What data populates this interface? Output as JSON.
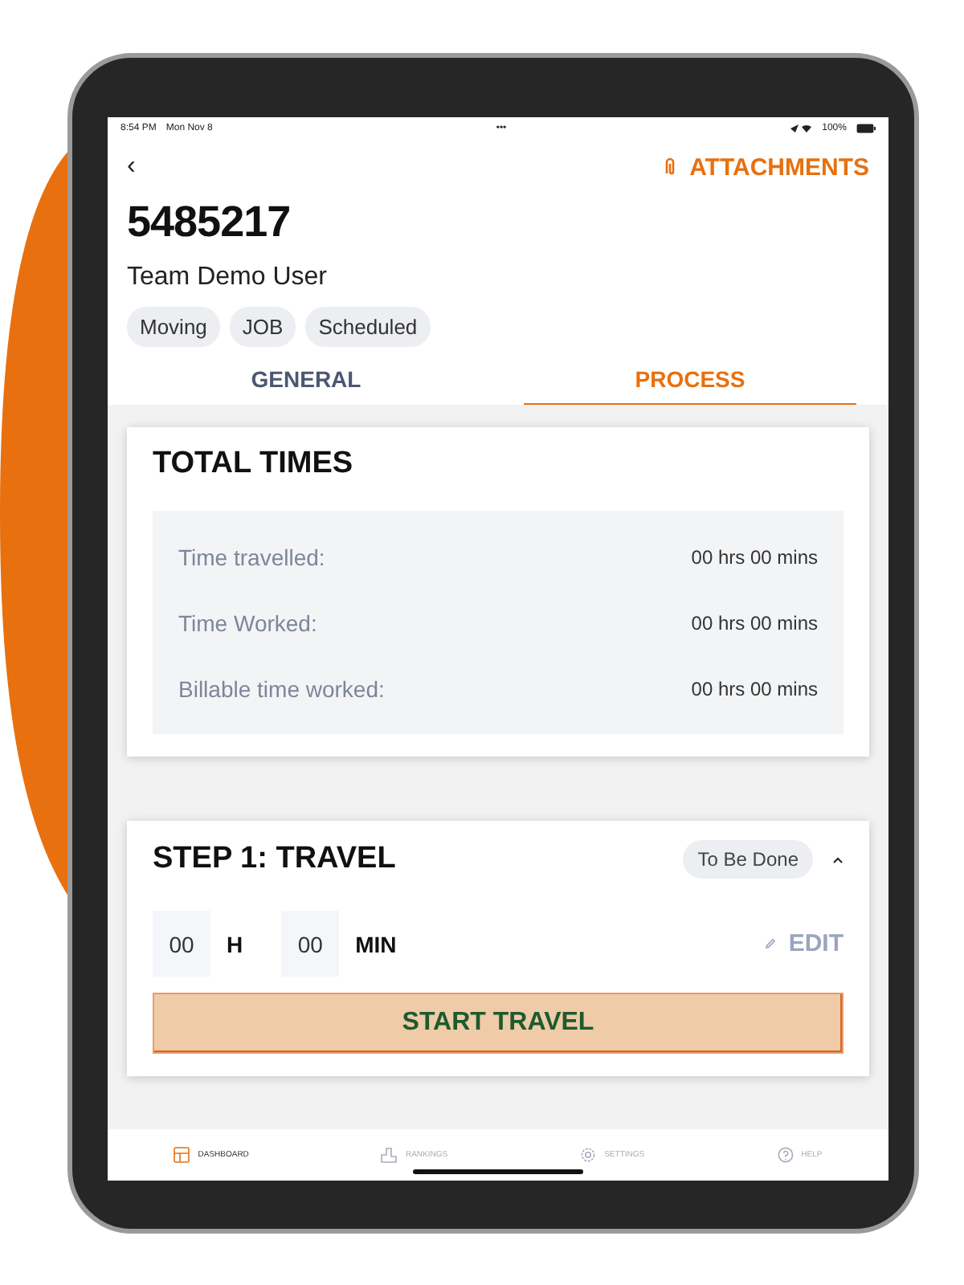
{
  "status_bar": {
    "time": "8:54 PM",
    "date": "Mon Nov 8",
    "dots": "•••",
    "battery": "100%"
  },
  "header": {
    "back": "‹",
    "attachments": "ATTACHMENTS"
  },
  "job": {
    "number": "5485217",
    "user": "Team Demo User",
    "tags": [
      "Moving",
      "JOB",
      "Scheduled"
    ]
  },
  "tabs": [
    {
      "label": "GENERAL",
      "selected": false
    },
    {
      "label": "PROCESS",
      "selected": true
    }
  ],
  "total_times": {
    "title": "TOTAL TIMES",
    "rows": [
      {
        "label": "Time travelled:",
        "value": "00 hrs 00 mins"
      },
      {
        "label": "Time Worked:",
        "value": "00 hrs 00 mins"
      },
      {
        "label": "Billable time worked:",
        "value": "00 hrs 00 mins"
      }
    ]
  },
  "step": {
    "title": "STEP 1: TRAVEL",
    "status": "To Be Done",
    "expanded": true,
    "hours": "00",
    "hours_unit": "H",
    "minutes": "00",
    "minutes_unit": "MIN",
    "edit": "EDIT",
    "action": "START TRAVEL"
  },
  "bottom_nav": [
    {
      "label": "DASHBOARD",
      "kind": "dashboard",
      "selected": true
    },
    {
      "label": "RANKINGS",
      "kind": "rankings",
      "selected": false
    },
    {
      "label": "SETTINGS",
      "kind": "settings",
      "selected": false
    },
    {
      "label": "HELP",
      "kind": "help",
      "selected": false
    }
  ]
}
